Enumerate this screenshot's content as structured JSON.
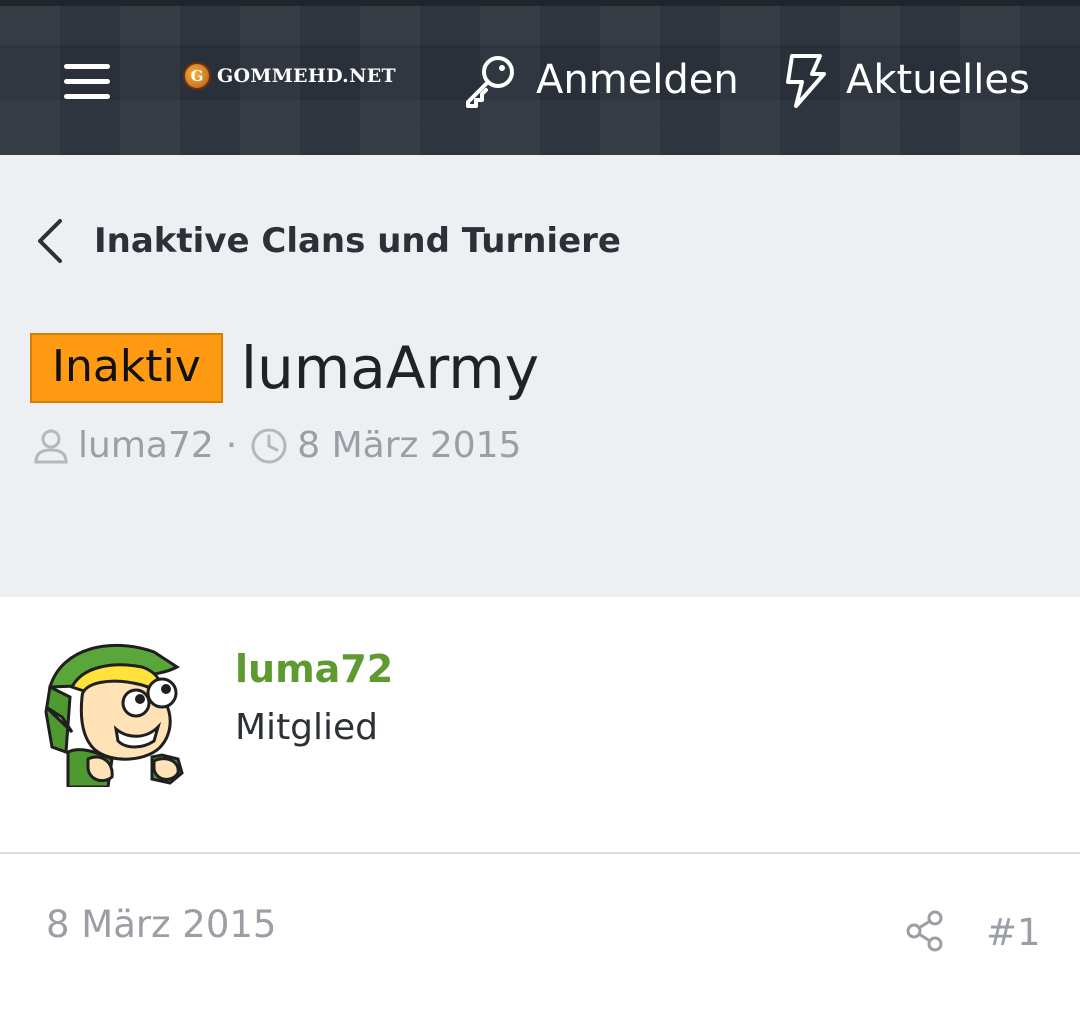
{
  "topbar": {
    "logo_text": "GOMMEHD.NET",
    "logo_letter": "G",
    "login_label": "Anmelden",
    "news_label": "Aktuelles",
    "icons": {
      "menu": "menu-icon",
      "login": "key-icon",
      "news": "bolt-icon"
    }
  },
  "header": {
    "breadcrumb": "Inaktive Clans und Turniere",
    "prefix": "Inaktiv",
    "title": "lumaArmy",
    "meta_author": "luma72",
    "meta_separator": "·",
    "meta_date": "8 März 2015"
  },
  "post": {
    "author": "luma72",
    "role": "Mitglied",
    "date": "8 März 2015",
    "number": "#1"
  },
  "colors": {
    "topbar": "#2c333c",
    "header_bg": "#eeeff3",
    "prefix_bg": "#ff9b12",
    "username": "#5e9a2f",
    "muted": "#9b9ea4"
  }
}
